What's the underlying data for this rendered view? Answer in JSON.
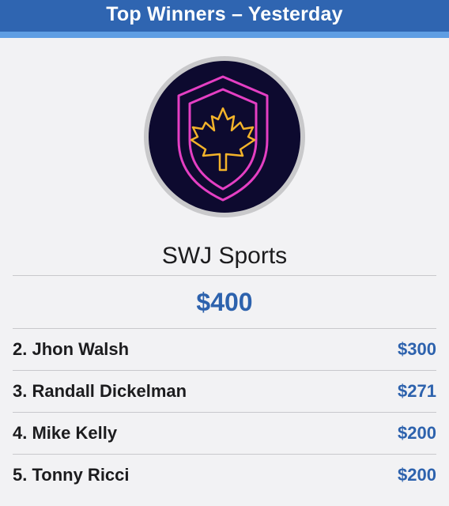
{
  "header": {
    "title": "Top Winners – Yesterday"
  },
  "winner": {
    "logo_icon": "maple-leaf-shield-icon",
    "name": "SWJ Sports",
    "amount": "$400"
  },
  "ranks": [
    {
      "name": "2. Jhon Walsh",
      "amount": "$300"
    },
    {
      "name": "3. Randall Dickelman",
      "amount": "$271"
    },
    {
      "name": "4. Mike Kelly",
      "amount": "$200"
    },
    {
      "name": "5. Tonny Ricci",
      "amount": "$200"
    }
  ],
  "colors": {
    "header_bg": "#2f65b1",
    "header_accent": "#5f9ee3",
    "amount": "#2d62ad",
    "logo_bg": "#0d0a2f",
    "shield": "#e43fc3",
    "leaf": "#f3b32a"
  }
}
